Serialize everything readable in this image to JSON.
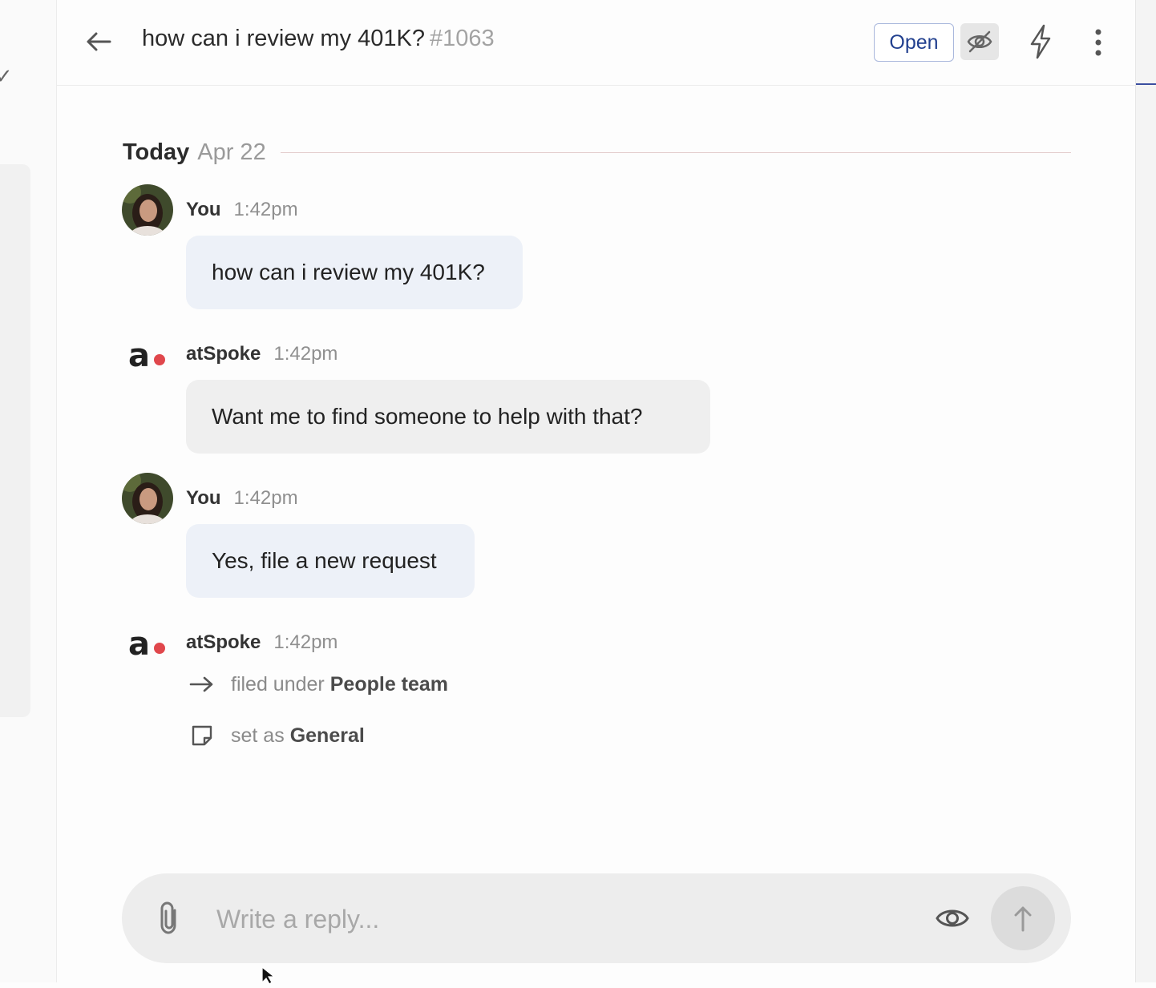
{
  "header": {
    "back_icon": "arrow-left-icon",
    "title": "how can i review my 401K?",
    "ticket_number": "#1063",
    "status_label": "Open",
    "hide_icon": "eye-off-icon",
    "bolt_icon": "lightning-icon",
    "more_icon": "kebab-menu-icon"
  },
  "date_separator": {
    "today": "Today",
    "date": "Apr 22"
  },
  "messages": [
    {
      "author": "You",
      "time": "1:42pm",
      "text": "how can i review my 401K?"
    },
    {
      "author": "atSpoke",
      "time": "1:42pm",
      "text": "Want me to find someone to help with that?"
    },
    {
      "author": "You",
      "time": "1:42pm",
      "text": "Yes, file a new request"
    },
    {
      "author": "atSpoke",
      "time": "1:42pm"
    }
  ],
  "events": [
    {
      "icon": "arrow-right-icon",
      "prefix": "filed under",
      "value": "People team"
    },
    {
      "icon": "note-icon",
      "prefix": "set as",
      "value": "General"
    }
  ],
  "composer": {
    "placeholder": "Write a reply...",
    "attach_icon": "paperclip-icon",
    "visibility_icon": "eye-icon",
    "send_icon": "arrow-up-icon"
  },
  "colors": {
    "accent": "#22408f",
    "user_bubble": "#edf1f8",
    "bot_bubble": "#efefef",
    "brand_dot": "#e0474c"
  }
}
